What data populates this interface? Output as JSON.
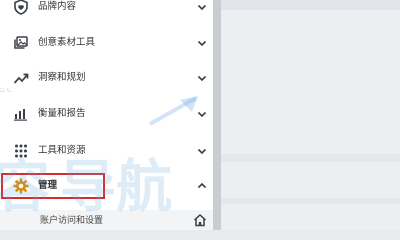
{
  "sidebar": {
    "items": [
      {
        "label": "品牌内容",
        "icon": "shield-heart-icon"
      },
      {
        "label": "创意素材工具",
        "icon": "media-library-icon"
      },
      {
        "label": "洞察和规划",
        "icon": "trend-up-icon"
      },
      {
        "label": "衡量和报告",
        "icon": "bar-chart-icon"
      },
      {
        "label": "工具和资源",
        "icon": "grid-dots-icon"
      },
      {
        "label": "管理",
        "icon": "gear-icon",
        "expanded": true
      }
    ],
    "sub_item": {
      "label": "账户访问和设置",
      "icon": "home-icon"
    }
  },
  "watermark": {
    "text": "导航"
  },
  "colors": {
    "highlight_border": "#d62b2b",
    "gear_accent": "#e08a00",
    "text": "#333333"
  }
}
